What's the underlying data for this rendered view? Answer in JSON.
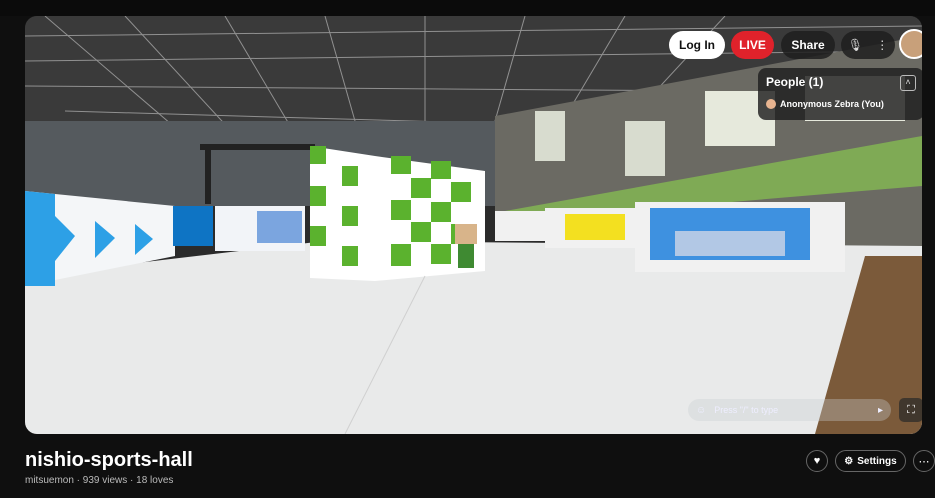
{
  "header": {
    "login_label": "Log In",
    "live_label": "LIVE",
    "share_label": "Share",
    "mic_icon": "mic-muted-icon",
    "menu_icon": "vertical-dots-icon"
  },
  "people_panel": {
    "title": "People (1)",
    "members": [
      {
        "name": "Anonymous Zebra (You)"
      }
    ]
  },
  "chat": {
    "placeholder": "Press \"/\" to type"
  },
  "space": {
    "title": "nishio-sports-hall",
    "meta": "mitsuemon · 939 views · 18 loves"
  },
  "actions": {
    "settings_label": "Settings",
    "heart_icon": "heart-icon",
    "more_icon": "more-horizontal-icon"
  },
  "colors": {
    "live": "#e0222b",
    "background": "#0f0f0f",
    "booth_green": "#5bb22e"
  }
}
